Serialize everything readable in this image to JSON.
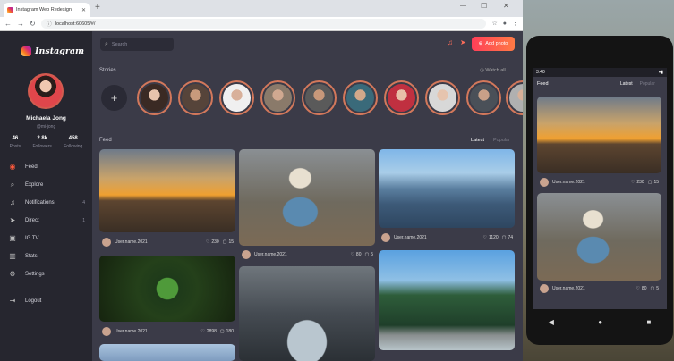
{
  "browser": {
    "tab_title": "Instagram Web Redesign",
    "url": "localhost:60605/#/"
  },
  "sidebar": {
    "logo_text": "Instagram",
    "profile": {
      "name": "Michaela Jong",
      "username": "@mi-jong"
    },
    "stats": [
      {
        "value": "46",
        "label": "Posts"
      },
      {
        "value": "2.8k",
        "label": "Followers"
      },
      {
        "value": "458",
        "label": "Following"
      }
    ],
    "nav": [
      {
        "label": "Feed",
        "count": "",
        "icon": "grid-icon",
        "active": true
      },
      {
        "label": "Explore",
        "count": "",
        "icon": "search-icon",
        "active": false
      },
      {
        "label": "Notifications",
        "count": "4",
        "icon": "bell-icon",
        "active": false
      },
      {
        "label": "Direct",
        "count": "1",
        "icon": "send-icon",
        "active": false
      },
      {
        "label": "IG TV",
        "count": "",
        "icon": "tv-icon",
        "active": false
      },
      {
        "label": "Stats",
        "count": "",
        "icon": "chart-icon",
        "active": false
      },
      {
        "label": "Settings",
        "count": "",
        "icon": "gear-icon",
        "active": false
      },
      {
        "label": "Logout",
        "count": "",
        "icon": "logout-icon",
        "active": false
      }
    ]
  },
  "header": {
    "search_placeholder": "Search",
    "add_photo_label": "Add photo"
  },
  "stories": {
    "title": "Stories",
    "watch_all": "Watch all"
  },
  "feed": {
    "title": "Feed",
    "tabs": [
      "Latest",
      "Popular"
    ],
    "posts": [
      {
        "user": "User.name.2021",
        "likes": "230",
        "comments": "15"
      },
      {
        "user": "User.name.2021",
        "likes": "80",
        "comments": "5"
      },
      {
        "user": "User.name.2021",
        "likes": "1120",
        "comments": "74"
      },
      {
        "user": "User.name.2021",
        "likes": "2898",
        "comments": "180"
      }
    ]
  },
  "phone": {
    "time": "3:40",
    "feed_title": "Feed",
    "tabs": [
      "Latest",
      "Popular"
    ],
    "posts": [
      {
        "user": "User.name.2021",
        "likes": "230",
        "comments": "15"
      },
      {
        "user": "User.name.2021",
        "likes": "80",
        "comments": "5"
      }
    ]
  },
  "colors": {
    "accent": "#ff5a3c",
    "sidebar_bg": "#26262f",
    "main_bg": "#3b3b48"
  }
}
